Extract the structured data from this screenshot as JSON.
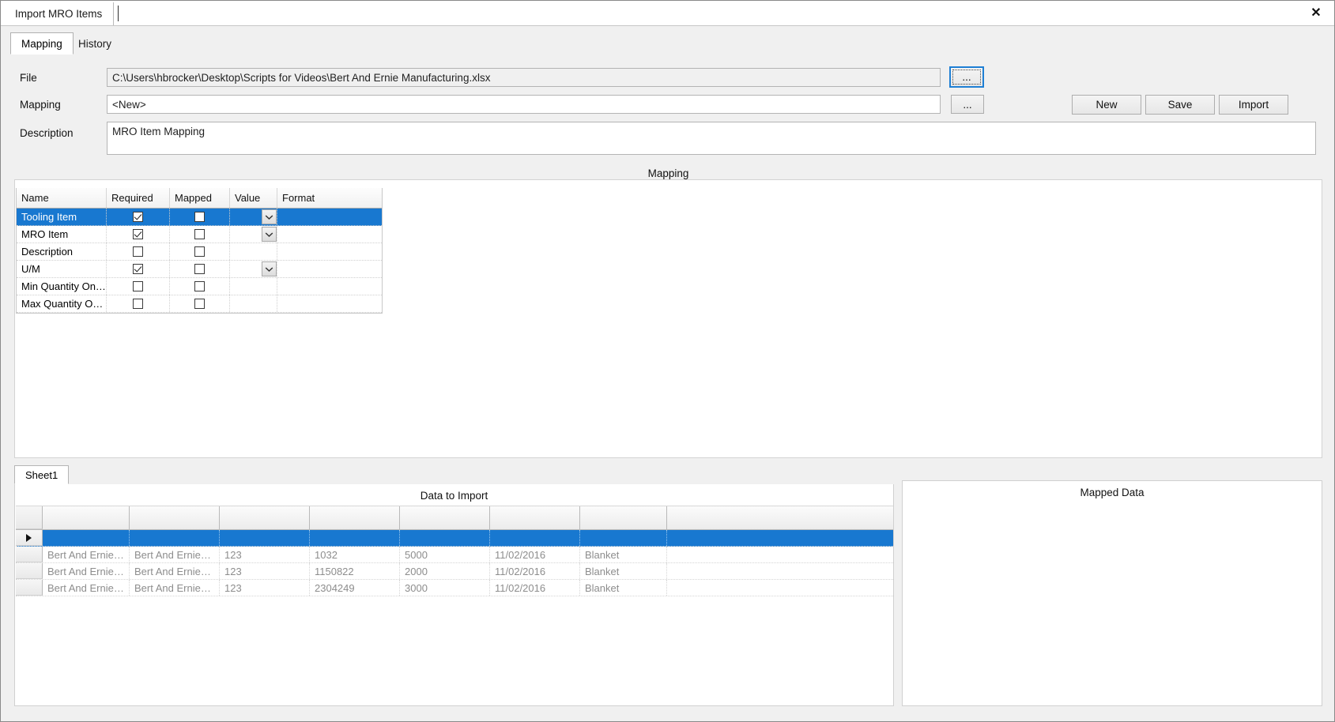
{
  "window": {
    "document_tab": "Import MRO Items",
    "close_label": "✕"
  },
  "tabs": [
    {
      "label": "Mapping",
      "active": true
    },
    {
      "label": "History",
      "active": false
    }
  ],
  "form": {
    "file_label": "File",
    "file_value": "C:\\Users\\hbrocker\\Desktop\\Scripts for Videos\\Bert And Ernie Manufacturing.xlsx",
    "mapping_label": "Mapping",
    "mapping_value": "<New>",
    "description_label": "Description",
    "description_value": "MRO Item Mapping",
    "file_browse_label": "...",
    "mapping_browse_label": "...",
    "new_label": "New",
    "save_label": "Save",
    "import_label": "Import"
  },
  "mapping_group": {
    "caption": "Mapping",
    "columns": [
      "Name",
      "Required",
      "Mapped",
      "Value",
      "Format"
    ],
    "rows": [
      {
        "name": "Tooling Item",
        "required": true,
        "mapped": false,
        "has_dropdown": true,
        "value": "",
        "format": "",
        "selected": true
      },
      {
        "name": "MRO Item",
        "required": true,
        "mapped": false,
        "has_dropdown": true,
        "value": "",
        "format": "",
        "selected": false
      },
      {
        "name": "Description",
        "required": false,
        "mapped": false,
        "has_dropdown": false,
        "value": "",
        "format": "",
        "selected": false
      },
      {
        "name": "U/M",
        "required": true,
        "mapped": false,
        "has_dropdown": true,
        "value": "",
        "format": "",
        "selected": false
      },
      {
        "name": "Min Quantity On…",
        "required": false,
        "mapped": false,
        "has_dropdown": false,
        "value": "",
        "format": "",
        "selected": false
      },
      {
        "name": "Max Quantity O…",
        "required": false,
        "mapped": false,
        "has_dropdown": false,
        "value": "",
        "format": "",
        "selected": false
      }
    ]
  },
  "data_panel": {
    "sheet_tab": "Sheet1",
    "caption": "Data to Import",
    "headers": [
      "",
      "",
      "",
      "",
      "",
      "",
      ""
    ],
    "rows": [
      {
        "selected": true,
        "cells": [
          "",
          "",
          "",
          "",
          "",
          "",
          ""
        ]
      },
      {
        "selected": false,
        "cells": [
          "Bert And Ernie…",
          "Bert And Ernie…",
          "123",
          "1032",
          "5000",
          "11/02/2016",
          "Blanket"
        ]
      },
      {
        "selected": false,
        "cells": [
          "Bert And Ernie…",
          "Bert And Ernie…",
          "123",
          "1150822",
          "2000",
          "11/02/2016",
          "Blanket"
        ]
      },
      {
        "selected": false,
        "cells": [
          "Bert And Ernie…",
          "Bert And Ernie…",
          "123",
          "2304249",
          "3000",
          "11/02/2016",
          "Blanket"
        ]
      }
    ]
  },
  "mapped_panel": {
    "caption": "Mapped Data"
  },
  "colors": {
    "selection_blue": "#1878d0",
    "focus_blue": "#1e7fd4",
    "window_gray": "#f0f0f0"
  }
}
